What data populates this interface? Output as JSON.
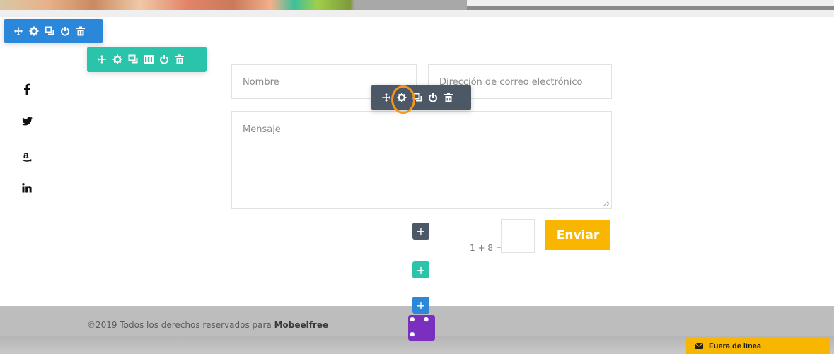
{
  "form": {
    "name_placeholder": "Nombre",
    "email_placeholder": "Dirección de correo electrónico",
    "message_placeholder": "Mensaje",
    "captcha_label": "1 + 8 =",
    "captcha_value": "",
    "submit_label": "Enviar"
  },
  "social": {
    "items": [
      "facebook-icon",
      "twitter-icon",
      "amazon-icon",
      "linkedin-icon"
    ],
    "glyphs": [
      "f",
      "🐦",
      "a",
      "in"
    ]
  },
  "builder": {
    "row_toolbar_tools": [
      "move-icon",
      "gear-icon",
      "duplicate-icon",
      "power-icon",
      "trash-icon"
    ],
    "section_toolbar_tools": [
      "move-icon",
      "gear-icon",
      "duplicate-icon",
      "columns-icon",
      "power-icon",
      "trash-icon"
    ],
    "module_toolbar_tools": [
      "move-icon",
      "gear-icon",
      "duplicate-icon",
      "power-icon",
      "trash-icon"
    ],
    "add_symbol": "+",
    "more_symbol": "• • •"
  },
  "footer": {
    "copyright_prefix": "©2019 Todos los derechos reservados para ",
    "brand": "Mobeelfree"
  },
  "chat": {
    "label": "Fuera de línea"
  },
  "colors": {
    "blue": "#2b87da",
    "green": "#29c4a9",
    "dark": "#4c5866",
    "purple": "#7b2fbe",
    "accent": "#f9b600",
    "highlight": "#f7941d"
  }
}
